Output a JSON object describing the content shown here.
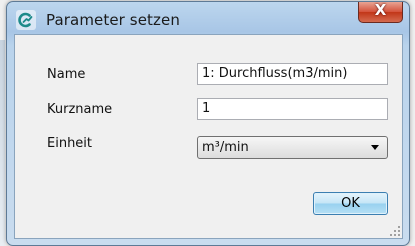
{
  "window": {
    "title": "Parameter setzen",
    "icon": "app-logo-icon",
    "close_label": "X"
  },
  "form": {
    "name_label": "Name",
    "name_value": "1: Durchfluss(m3/min)",
    "kurzname_label": "Kurzname",
    "kurzname_value": "1",
    "einheit_label": "Einheit",
    "einheit_selected": "m³/min"
  },
  "buttons": {
    "ok_label": "OK"
  }
}
